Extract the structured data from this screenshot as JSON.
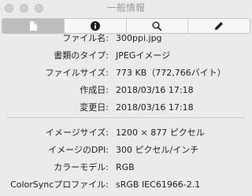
{
  "window": {
    "title": "一般情報"
  },
  "tabs": [
    {
      "name": "general",
      "icon": "document-icon",
      "active": true
    },
    {
      "name": "info",
      "icon": "info-icon",
      "active": false
    },
    {
      "name": "search",
      "icon": "magnifier-icon",
      "active": false
    },
    {
      "name": "edit",
      "icon": "pencil-icon",
      "active": false
    }
  ],
  "general": {
    "filename_label": "ファイル名:",
    "filename_value": "300ppi.jpg",
    "kind_label": "書類のタイプ:",
    "kind_value": "JPEGイメージ",
    "size_label": "ファイルサイズ:",
    "size_value": "773 KB（772,766バイト）",
    "created_label": "作成日:",
    "created_value": "2018/03/16 17:18",
    "modified_label": "変更日:",
    "modified_value": "2018/03/16 17:18"
  },
  "image": {
    "dimensions_label": "イメージサイズ:",
    "dimensions_value": "1200 × 877 ピクセル",
    "dpi_label": "イメージのDPI:",
    "dpi_value": "300 ピクセル/インチ",
    "colormodel_label": "カラーモデル:",
    "colormodel_value": "RGB",
    "colorsync_label": "ColorSyncプロファイル:",
    "colorsync_value": "sRGB IEC61966-2.1"
  }
}
